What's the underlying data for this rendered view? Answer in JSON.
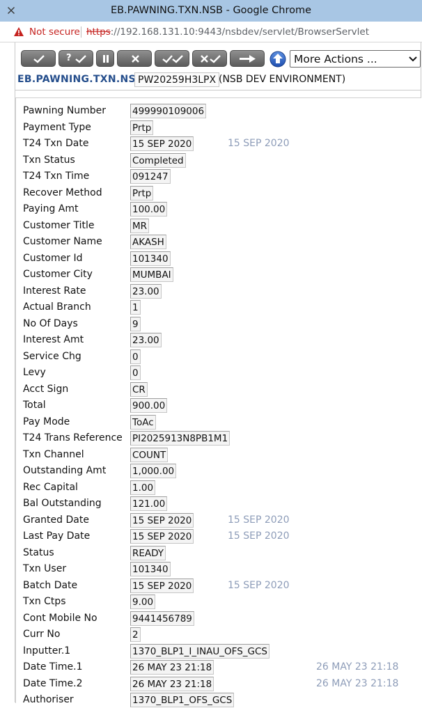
{
  "window": {
    "title": "EB.PAWNING.TXN.NSB - Google Chrome"
  },
  "address_bar": {
    "security_text": "Not secure",
    "url_scheme": "https",
    "url_rest": "://192.168.131.10:9443/nsbdev/servlet/BrowserServlet"
  },
  "toolbar": {
    "buttons": [
      {
        "label": "",
        "icon": "commit-check-icon"
      },
      {
        "label": "?",
        "icon": "validate-check-icon"
      },
      {
        "label": "",
        "icon": "hold-pause-icon"
      },
      {
        "label": "",
        "icon": "delete-x-icon"
      },
      {
        "label": "",
        "icon": "authorise-double-check-icon"
      },
      {
        "label": "",
        "icon": "reverse-x-check-icon"
      },
      {
        "label": "",
        "icon": "next-arrow-icon"
      }
    ],
    "more_actions": "More Actions ..."
  },
  "header": {
    "application": "EB.PAWNING.TXN.NSB",
    "record_id": "PW20259H3LPX",
    "environment": "(NSB DEV ENVIRONMENT)"
  },
  "colors": {
    "title_bar": "#a8c6e4",
    "header_text": "#254e8c",
    "enrichment_text": "#8d9cb8",
    "warning_red": "#c5221f"
  },
  "fields": [
    {
      "label": "Pawning Number",
      "value": "499990109006",
      "enrichment": ""
    },
    {
      "label": "Payment Type",
      "value": "Prtp",
      "enrichment": ""
    },
    {
      "label": "T24 Txn Date",
      "value": "15 SEP 2020",
      "enrichment": "15 SEP 2020"
    },
    {
      "label": "Txn Status",
      "value": "Completed",
      "enrichment": ""
    },
    {
      "label": "T24 Txn Time",
      "value": "091247",
      "enrichment": ""
    },
    {
      "label": "Recover Method",
      "value": "Prtp",
      "enrichment": ""
    },
    {
      "label": "Paying Amt",
      "value": "100.00",
      "enrichment": ""
    },
    {
      "label": "Customer Title",
      "value": "MR",
      "enrichment": ""
    },
    {
      "label": "Customer Name",
      "value": "AKASH",
      "enrichment": ""
    },
    {
      "label": "Customer Id",
      "value": "101340",
      "enrichment": ""
    },
    {
      "label": "Customer City",
      "value": "MUMBAI",
      "enrichment": ""
    },
    {
      "label": "Interest Rate",
      "value": "23.00",
      "enrichment": ""
    },
    {
      "label": "Actual Branch",
      "value": "1",
      "enrichment": ""
    },
    {
      "label": "No Of Days",
      "value": "9",
      "enrichment": ""
    },
    {
      "label": "Interest Amt",
      "value": "23.00",
      "enrichment": ""
    },
    {
      "label": "Service Chg",
      "value": "0",
      "enrichment": ""
    },
    {
      "label": "Levy",
      "value": "0",
      "enrichment": ""
    },
    {
      "label": "Acct Sign",
      "value": "CR",
      "enrichment": ""
    },
    {
      "label": "Total",
      "value": "900.00",
      "enrichment": ""
    },
    {
      "label": "Pay Mode",
      "value": "ToAc",
      "enrichment": ""
    },
    {
      "label": "T24 Trans Reference",
      "value": "PI2025913N8PB1M1",
      "enrichment": ""
    },
    {
      "label": "Txn Channel",
      "value": "COUNT",
      "enrichment": ""
    },
    {
      "label": "Outstanding Amt",
      "value": "1,000.00",
      "enrichment": ""
    },
    {
      "label": "Rec Capital",
      "value": "1.00",
      "enrichment": ""
    },
    {
      "label": "Bal Outstanding",
      "value": "121.00",
      "enrichment": ""
    },
    {
      "label": "Granted Date",
      "value": "15 SEP 2020",
      "enrichment": "15 SEP 2020"
    },
    {
      "label": "Last Pay Date",
      "value": "15 SEP 2020",
      "enrichment": "15 SEP 2020"
    },
    {
      "label": "Status",
      "value": "READY",
      "enrichment": ""
    },
    {
      "label": "Txn User",
      "value": "101340",
      "enrichment": ""
    },
    {
      "label": "Batch Date",
      "value": "15 SEP 2020",
      "enrichment": "15 SEP 2020"
    },
    {
      "label": "Txn Ctps",
      "value": "9.00",
      "enrichment": ""
    },
    {
      "label": "Cont Mobile No",
      "value": "9441456789",
      "enrichment": ""
    },
    {
      "label": "Curr No",
      "value": "2",
      "enrichment": ""
    },
    {
      "label": "Inputter.1",
      "value": "1370_BLP1_I_INAU_OFS_GCS",
      "enrichment": ""
    },
    {
      "label": "Date Time.1",
      "value": "26 MAY 23 21:18",
      "enrichment": "26 MAY 23 21:18",
      "far": true
    },
    {
      "label": "Date Time.2",
      "value": "26 MAY 23 21:18",
      "enrichment": "26 MAY 23 21:18",
      "far": true
    },
    {
      "label": "Authoriser",
      "value": "1370_BLP1_OFS_GCS",
      "enrichment": ""
    }
  ]
}
